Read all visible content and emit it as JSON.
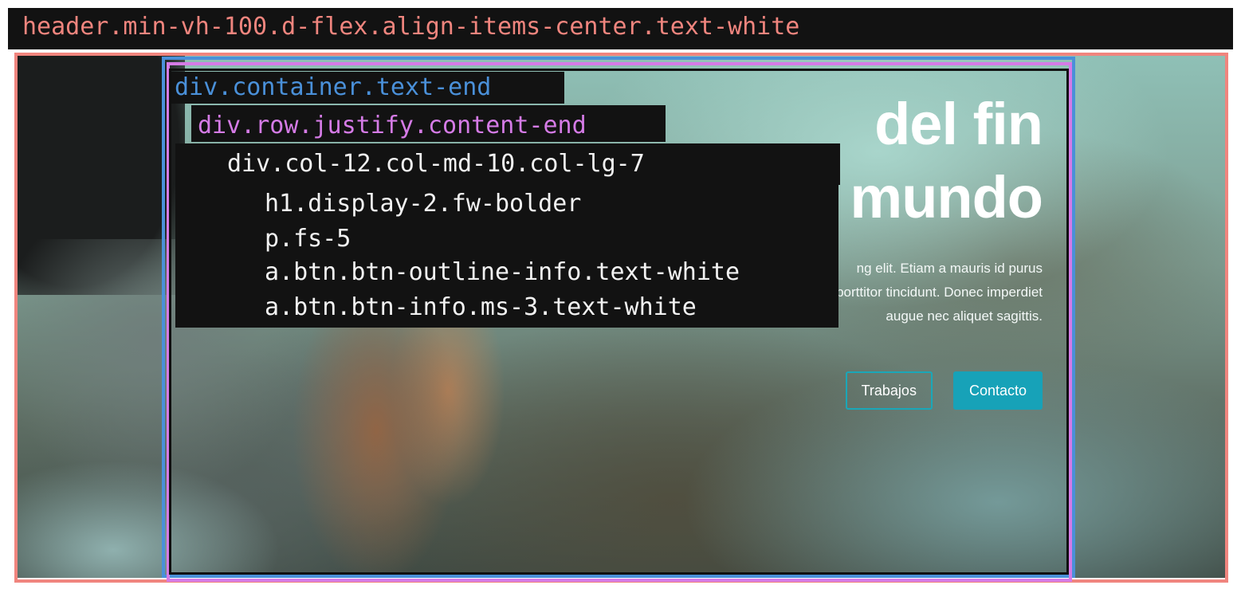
{
  "annotations": {
    "header_selector": "header.min-vh-100.d-flex.align-items-center.text-white",
    "container_selector": "div.container.text-end",
    "row_selector": "div.row.justify.content-end",
    "col_selector": "div.col-12.col-md-10.col-lg-7",
    "children": [
      "h1.display-2.fw-bolder",
      "p.fs-5",
      "a.btn.btn-outline-info.text-white",
      "a.btn.btn-info.ms-3.text-white"
    ]
  },
  "colors": {
    "header_outline": "#f0857e",
    "container_outline": "#4a90d9",
    "row_outline": "#d57be6",
    "col_outline": "#101010",
    "btn_info": "#17a2b8",
    "annotation_bg": "#121212",
    "annotation_text": "#f2f2f2"
  },
  "hero": {
    "title_line1": "del fin",
    "title_line2": "mundo",
    "paragraph_line1": "ng elit. Etiam a mauris id purus",
    "paragraph_line2": "blandit dapibus. Nunc at enim et lacus porttitor tincidunt. Donec imperdiet",
    "paragraph_line3": "augue nec aliquet sagittis.",
    "button_outline_label": "Trabajos",
    "button_solid_label": "Contacto"
  }
}
